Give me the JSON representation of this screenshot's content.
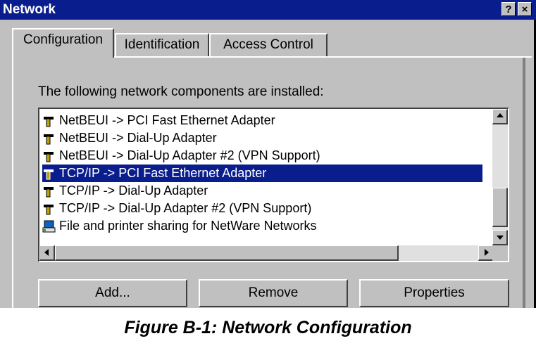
{
  "window": {
    "title": "Network",
    "help_button": "?",
    "close_button": "×"
  },
  "tabs": [
    {
      "label": "Configuration",
      "active": true
    },
    {
      "label": "Identification",
      "active": false
    },
    {
      "label": "Access Control",
      "active": false
    }
  ],
  "components": {
    "caption": "The following network components are installed:",
    "items": [
      {
        "icon": "protocol-icon",
        "label": "NetBEUI -> PCI Fast Ethernet Adapter",
        "selected": false
      },
      {
        "icon": "protocol-icon",
        "label": "NetBEUI -> Dial-Up Adapter",
        "selected": false
      },
      {
        "icon": "protocol-icon",
        "label": "NetBEUI -> Dial-Up Adapter #2 (VPN Support)",
        "selected": false
      },
      {
        "icon": "protocol-icon",
        "label": "TCP/IP -> PCI Fast Ethernet Adapter",
        "selected": true
      },
      {
        "icon": "protocol-icon",
        "label": "TCP/IP -> Dial-Up Adapter",
        "selected": false
      },
      {
        "icon": "protocol-icon",
        "label": "TCP/IP -> Dial-Up Adapter #2 (VPN Support)",
        "selected": false
      },
      {
        "icon": "file-printer-sharing-icon",
        "label": "File and printer sharing for NetWare Networks",
        "selected": false
      }
    ]
  },
  "buttons": {
    "add": "Add...",
    "remove": "Remove",
    "properties": "Properties"
  },
  "figure_caption": "Figure B-1: Network Configuration",
  "colors": {
    "titlebar": "#0a1d8c",
    "selection": "#0a1d8c",
    "face": "#c0c0c0"
  }
}
